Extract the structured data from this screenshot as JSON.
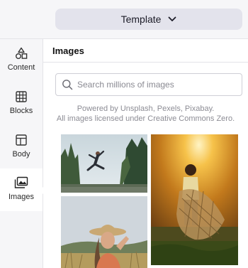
{
  "header": {
    "template_label": "Template",
    "template_icon": "chevron-down-icon"
  },
  "sidebar": {
    "items": [
      {
        "label": "Content",
        "icon": "shapes-icon",
        "active": false
      },
      {
        "label": "Blocks",
        "icon": "blocks-grid-icon",
        "active": false
      },
      {
        "label": "Body",
        "icon": "layout-icon",
        "active": false
      },
      {
        "label": "Images",
        "icon": "images-icon",
        "active": true
      }
    ]
  },
  "panel": {
    "title": "Images",
    "search": {
      "placeholder": "Search millions of images",
      "value": ""
    },
    "credit_line1": "Powered by Unsplash, Pexels, Pixabay.",
    "credit_line2": "All images licensed under Creative Commons Zero."
  },
  "colors": {
    "topbar_bg": "#f6f6f8",
    "template_button_bg": "#e3e3ec",
    "accent_text": "#1c1c28"
  }
}
